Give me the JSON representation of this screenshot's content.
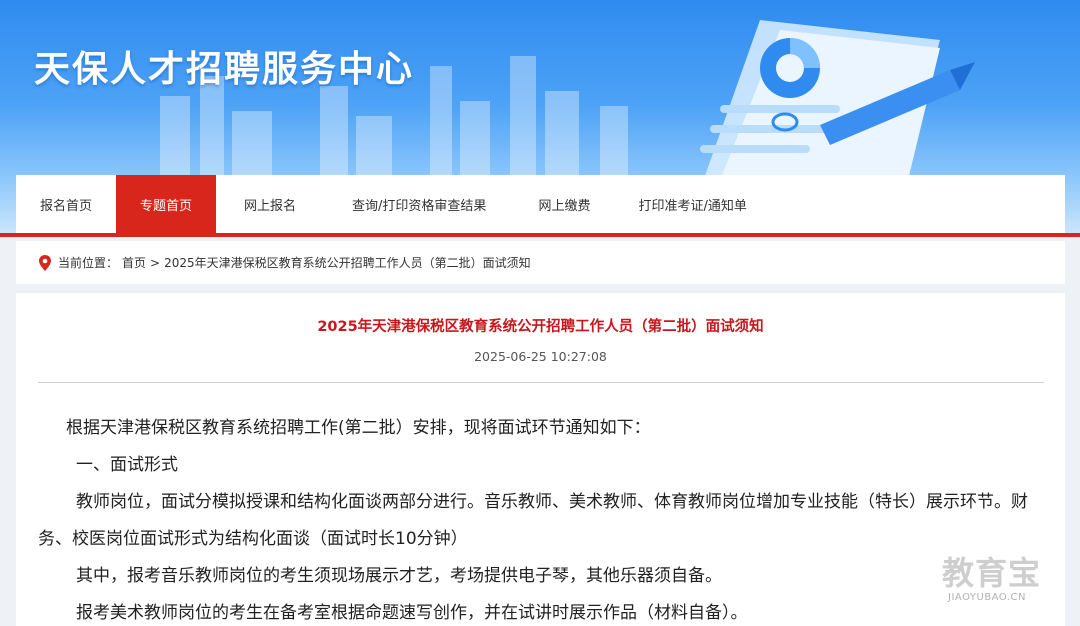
{
  "header": {
    "site_title": "天保人才招聘服务中心"
  },
  "nav": {
    "items": [
      {
        "label": "报名首页",
        "active": false
      },
      {
        "label": "专题首页",
        "active": true
      },
      {
        "label": "网上报名",
        "active": false
      },
      {
        "label": "查询/打印资格审查结果",
        "active": false
      },
      {
        "label": "网上缴费",
        "active": false
      },
      {
        "label": "打印准考证/通知单",
        "active": false
      }
    ],
    "accent_color": "#d9261c"
  },
  "breadcrumb": {
    "prefix": "当前位置：",
    "home": "首页",
    "separator": ">",
    "current": "2025年天津港保税区教育系统公开招聘工作人员（第二批）面试须知"
  },
  "article": {
    "title": "2025年天津港保税区教育系统公开招聘工作人员（第二批）面试须知",
    "date": "2025-06-25 10:27:08",
    "paragraphs": [
      "根据天津港保税区教育系统招聘工作(第二批）安排，现将面试环节通知如下：",
      "一、面试形式",
      "教师岗位，面试分模拟授课和结构化面谈两部分进行。音乐教师、美术教师、体育教师岗位增加专业技能（特长）展示环节。财务、校医岗位面试形式为结构化面谈（面试时长10分钟）",
      "其中，报考音乐教师岗位的考生须现场展示才艺，考场提供电子琴，其他乐器须自备。",
      "报考美术教师岗位的考生在备考室根据命题速写创作，并在试讲时展示作品（材料自备）。"
    ],
    "title_color": "#c8161d"
  },
  "watermark": {
    "cn": "教育宝",
    "en": "JIAOYUBAO.CN"
  }
}
